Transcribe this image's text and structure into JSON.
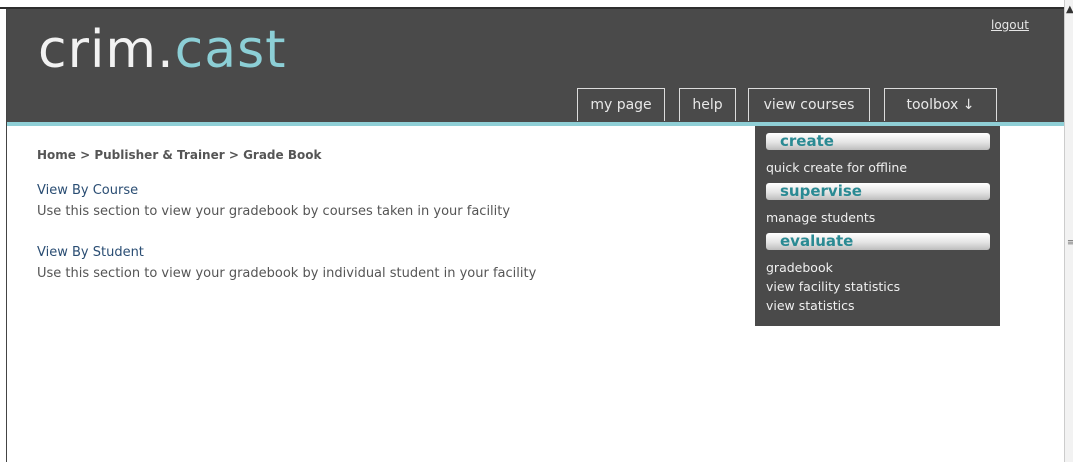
{
  "logo": {
    "text_white": "crim.",
    "text_accent": "cast"
  },
  "header": {
    "logout": "logout"
  },
  "tabs": [
    {
      "label": "my page"
    },
    {
      "label": "help"
    },
    {
      "label": "view courses"
    },
    {
      "label": "toolbox ↓"
    }
  ],
  "breadcrumb": "Home > Publisher & Trainer > Grade Book",
  "sections": [
    {
      "title": "View By Course",
      "description": "Use this section to view your gradebook by courses taken in your facility"
    },
    {
      "title": "View By Student",
      "description": "Use this section to view your gradebook by individual student in your facility"
    }
  ],
  "toolbox": {
    "groups": [
      {
        "heading": "create",
        "items": [
          "quick create for offline"
        ]
      },
      {
        "heading": "supervise",
        "items": [
          "manage students"
        ]
      },
      {
        "heading": "evaluate",
        "items": [
          "gradebook",
          "view facility statistics",
          "view statistics"
        ]
      }
    ]
  },
  "colors": {
    "header_bg": "#4a4a4a",
    "accent": "#8ccfd6",
    "link": "#2a4d73"
  }
}
